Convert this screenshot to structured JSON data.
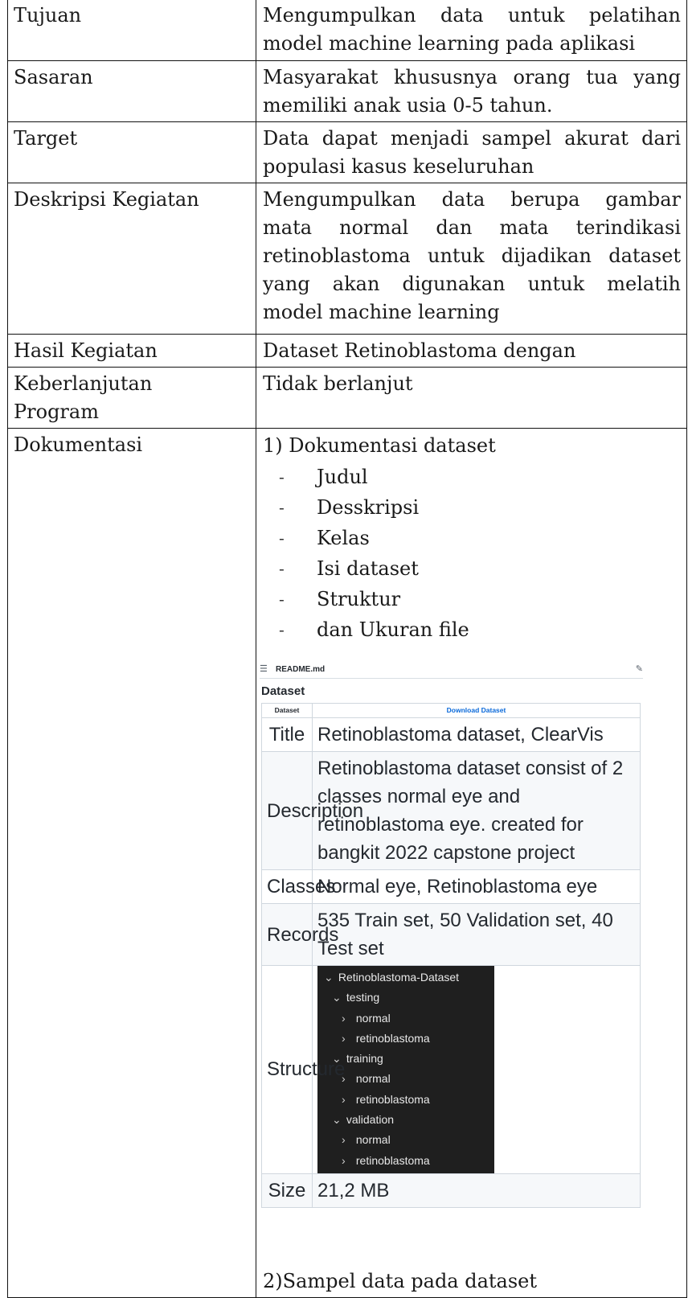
{
  "rows": [
    {
      "label": "Tujuan",
      "lines": [
        "Mengumpulkan data untuk pelatihan",
        "model machine learning pada aplikasi"
      ]
    },
    {
      "label": "Sasaran",
      "lines": [
        "Masyarakat khususnya orang tua yang",
        "memiliki anak usia 0-5 tahun."
      ]
    },
    {
      "label": "Target",
      "lines": [
        "Data dapat menjadi sampel akurat dari",
        "populasi kasus keseluruhan"
      ]
    },
    {
      "label": "Deskripsi Kegiatan",
      "lines": [
        "Mengumpulkan data berupa gambar",
        "mata normal dan mata terindikasi",
        "retinoblastoma untuk dijadikan dataset",
        "yang akan digunakan untuk melatih",
        "model machine learning"
      ]
    },
    {
      "label": "Hasil Kegiatan",
      "text": "Dataset Retinoblastoma dengan"
    },
    {
      "label_lines": [
        "Keberlanjutan",
        "Program"
      ],
      "text": "Tidak berlanjut"
    },
    {
      "label": "Dokumentasi"
    }
  ],
  "dokumentasi": {
    "heading1": "1) Dokumentasi dataset",
    "items": [
      "Judul",
      "Desskripsi",
      "Kelas",
      "Isi dataset",
      "Struktur",
      "dan Ukuran file"
    ],
    "dash": "-",
    "heading2": "2)Sampel data pada dataset"
  },
  "readme": {
    "filename": "README.md",
    "title": "Dataset",
    "header_key": "Dataset",
    "header_link": "Download Dataset",
    "rows": {
      "title_k": "Title",
      "title_v": "Retinoblastoma dataset, ClearVis",
      "desc_k": "Description",
      "desc_v": "Retinoblastoma dataset consist of 2 classes normal eye and retinoblastoma eye. created for bangkit 2022 capstone project",
      "classes_k": "Classes",
      "classes_v": "Normal eye, Retinoblastoma eye",
      "records_k": "Records",
      "records_v": "535 Train set, 50 Validation set, 40 Test set",
      "structure_k": "Structure",
      "size_k": "Size",
      "size_v": "21,2 MB"
    },
    "tree": {
      "root": "Retinoblastoma-Dataset",
      "testing": "testing",
      "testing_normal": "normal",
      "testing_retino": "retinoblastoma",
      "training": "training",
      "training_normal": "normal",
      "training_retino": "retinoblastoma",
      "validation": "validation",
      "validation_normal": "normal",
      "validation_retino": "retinoblastoma"
    },
    "icons": {
      "menu": "list-icon",
      "edit": "pencil-icon",
      "expanded": "chevron-down-icon",
      "collapsed": "chevron-right-icon"
    },
    "link_color": "#0969da"
  }
}
